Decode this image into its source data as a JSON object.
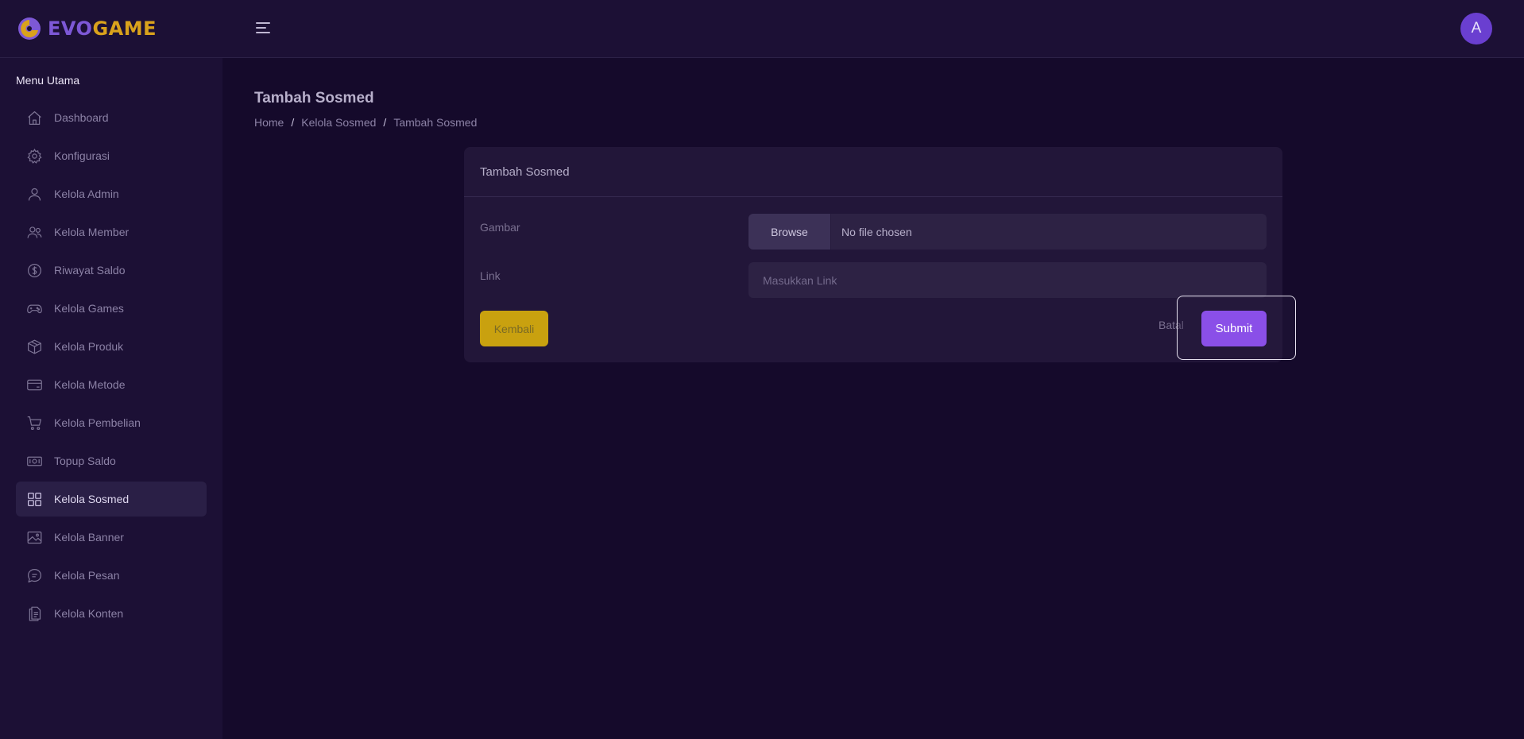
{
  "app": {
    "brand_part1": "EVO",
    "brand_part2": "GAME",
    "avatar_initial": "A"
  },
  "sidebar": {
    "title": "Menu Utama",
    "items": [
      {
        "label": "Dashboard",
        "icon": "home-icon",
        "active": false
      },
      {
        "label": "Konfigurasi",
        "icon": "gear-icon",
        "active": false
      },
      {
        "label": "Kelola Admin",
        "icon": "user-icon",
        "active": false
      },
      {
        "label": "Kelola Member",
        "icon": "users-icon",
        "active": false
      },
      {
        "label": "Riwayat Saldo",
        "icon": "dollar-circle-icon",
        "active": false
      },
      {
        "label": "Kelola Games",
        "icon": "gamepad-icon",
        "active": false
      },
      {
        "label": "Kelola Produk",
        "icon": "box-icon",
        "active": false
      },
      {
        "label": "Kelola Metode",
        "icon": "credit-card-icon",
        "active": false
      },
      {
        "label": "Kelola Pembelian",
        "icon": "cart-icon",
        "active": false
      },
      {
        "label": "Topup Saldo",
        "icon": "cash-icon",
        "active": false
      },
      {
        "label": "Kelola Sosmed",
        "icon": "grid-icon",
        "active": true
      },
      {
        "label": "Kelola Banner",
        "icon": "image-icon",
        "active": false
      },
      {
        "label": "Kelola Pesan",
        "icon": "chat-icon",
        "active": false
      },
      {
        "label": "Kelola Konten",
        "icon": "document-icon",
        "active": false
      }
    ]
  },
  "page": {
    "title": "Tambah Sosmed",
    "breadcrumb": {
      "home": "Home",
      "parent": "Kelola Sosmed",
      "current": "Tambah Sosmed",
      "separator": "/"
    }
  },
  "form": {
    "header": "Tambah Sosmed",
    "gambar_label": "Gambar",
    "browse_label": "Browse",
    "file_status": "No file chosen",
    "link_label": "Link",
    "link_placeholder": "Masukkan Link",
    "link_value": "",
    "back_label": "Kembali",
    "cancel_label": "Batal",
    "submit_label": "Submit"
  },
  "colors": {
    "background": "#150a2b",
    "panel": "#1c1035",
    "card": "#221639",
    "accent": "#8a4fe8",
    "warning": "#c9a10f",
    "brand_purple": "#7d58d6",
    "brand_gold": "#d9a21c"
  }
}
